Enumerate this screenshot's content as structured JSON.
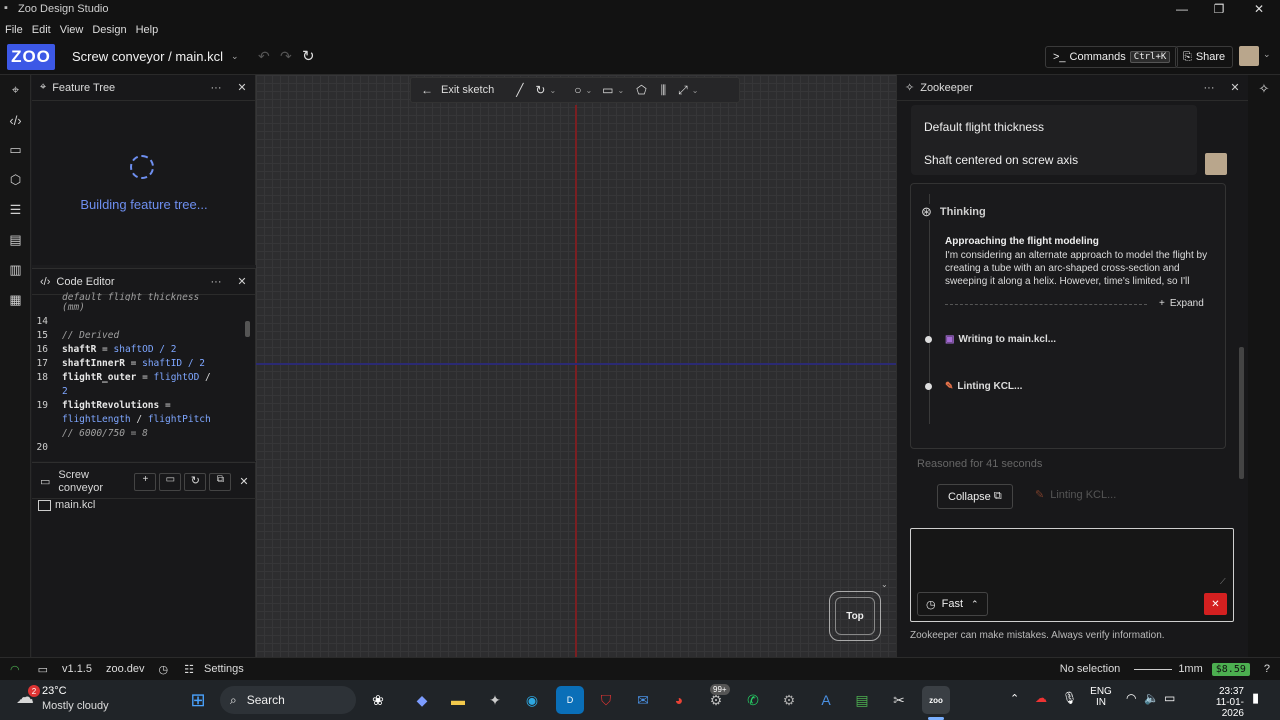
{
  "window": {
    "title": "Zoo Design Studio",
    "minimize": "—",
    "maximize": "❐",
    "close": "✕"
  },
  "menu": [
    "File",
    "Edit",
    "View",
    "Design",
    "Help"
  ],
  "header": {
    "logo": "ZOO",
    "project": "Screw conveyor / main.kcl",
    "commands_label": "Commands",
    "commands_shortcut": "Ctrl+K",
    "share_label": "Share"
  },
  "feature_tree": {
    "title": "Feature Tree",
    "status": "Building feature tree..."
  },
  "code_editor": {
    "title": "Code Editor",
    "partial_line": "default flight thickness",
    "lines": [
      {
        "n": "",
        "t": "(mm)"
      },
      {
        "n": "14",
        "t": ""
      },
      {
        "n": "15",
        "t": "// Derived"
      },
      {
        "n": "16",
        "a": "shaftR",
        "b": " = ",
        "c": "shaftOD",
        "d": " / 2"
      },
      {
        "n": "17",
        "a": "shaftInnerR",
        "b": " = ",
        "c": "shaftID",
        "d": " / 2"
      },
      {
        "n": "18",
        "a": "flightR_outer",
        "b": " = ",
        "c": "flightOD",
        "d": " /"
      },
      {
        "n": "",
        "t2": "2"
      },
      {
        "n": "19",
        "a": "flightRevolutions",
        "b": " =",
        "c": "",
        "d": ""
      },
      {
        "n": "",
        "c2": "flightLength",
        "d2": " / ",
        "e2": "flightPitch"
      },
      {
        "n": "",
        "t": "// 6000/750 = 8"
      },
      {
        "n": "20",
        "t": ""
      }
    ]
  },
  "files": {
    "title": "Screw conveyor",
    "items": [
      "main.kcl"
    ]
  },
  "sketch_toolbar": {
    "exit_label": "Exit sketch"
  },
  "viewcube": {
    "label": "Top"
  },
  "zookeeper": {
    "title": "Zookeeper",
    "suggestions": [
      "Default flight thickness",
      "Shaft centered on screw axis"
    ],
    "thinking_label": "Thinking",
    "heading": "Approaching the flight modeling",
    "body": "I'm considering an alternate approach to model the flight by creating a tube with an arc-shaped cross-section and sweeping it along a helix. However, time's limited, so I'll",
    "expand_label": "Expand",
    "step1": "Writing to main.kcl...",
    "step2": "Linting KCL...",
    "reasoned": "Reasoned for 41 seconds",
    "collapse_label": "Collapse",
    "linting_status": "Linting KCL...",
    "input_placeholder": "",
    "mode_label": "Fast",
    "disclaimer": "Zookeeper can make mistakes. Always verify information."
  },
  "status": {
    "version": "v1.1.5",
    "site": "zoo.dev",
    "settings": "Settings",
    "selection": "No selection",
    "units": "1mm",
    "credits": "$8.59",
    "help": "?"
  },
  "taskbar": {
    "weather_temp": "23°C",
    "weather_desc": "Mostly cloudy",
    "weather_badge": "2",
    "search": "Search",
    "badge": "99+",
    "lang1": "ENG",
    "lang2": "IN",
    "time": "23:37",
    "date": "11-01-2026"
  },
  "colors": {
    "accent": "#3c58e6",
    "axis_red": "#8b1d1d",
    "axis_blue": "#27276e",
    "stop": "#d42020",
    "credits_bg": "#4caf50"
  }
}
